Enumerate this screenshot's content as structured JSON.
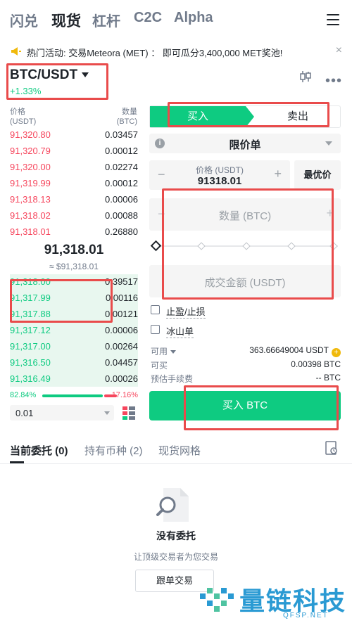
{
  "nav": {
    "tabs": [
      "闪兑",
      "现货",
      "杠杆",
      "C2C",
      "Alpha"
    ],
    "active_index": 1
  },
  "announcement": {
    "text": "热门活动: 交易Meteora (MET) ： 即可瓜分3,400,000 MET奖池!",
    "close": "×"
  },
  "pair": {
    "symbol": "BTC/USDT",
    "change": "+1.33%"
  },
  "orderbook": {
    "price_header": [
      "价格",
      "(USDT)"
    ],
    "qty_header": [
      "数量",
      "(BTC)"
    ],
    "asks": [
      {
        "price": "91,320.80",
        "qty": "0.03457"
      },
      {
        "price": "91,320.79",
        "qty": "0.00012"
      },
      {
        "price": "91,320.00",
        "qty": "0.02274"
      },
      {
        "price": "91,319.99",
        "qty": "0.00012"
      },
      {
        "price": "91,318.13",
        "qty": "0.00006"
      },
      {
        "price": "91,318.02",
        "qty": "0.00088"
      },
      {
        "price": "91,318.01",
        "qty": "0.26880"
      }
    ],
    "mid_price": "91,318.01",
    "mid_fiat": "≈ $91,318.01",
    "bids": [
      {
        "price": "91,318.00",
        "qty": "0.39517"
      },
      {
        "price": "91,317.99",
        "qty": "0.00116"
      },
      {
        "price": "91,317.88",
        "qty": "0.00121"
      },
      {
        "price": "91,317.12",
        "qty": "0.00006"
      },
      {
        "price": "91,317.00",
        "qty": "0.00264"
      },
      {
        "price": "91,316.50",
        "qty": "0.04457"
      },
      {
        "price": "91,316.49",
        "qty": "0.00026"
      }
    ],
    "buy_ratio": "82.84%",
    "sell_ratio": "17.16%",
    "depth": "0.01"
  },
  "form": {
    "buy_tab": "买入",
    "sell_tab": "卖出",
    "order_type": "限价单",
    "price_label": "价格 (USDT)",
    "price_value": "91318.01",
    "best_price": "最优价",
    "qty_placeholder": "数量 (BTC)",
    "amount_placeholder": "成交金额 (USDT)",
    "tpsl": "止盈/止损",
    "iceberg": "冰山单",
    "available_label": "可用",
    "available_value": "363.66649004 USDT",
    "can_buy_label": "可买",
    "can_buy_value": "0.00398 BTC",
    "fee_label": "预估手续费",
    "fee_value": "-- BTC",
    "buy_button": "买入 BTC"
  },
  "bottom": {
    "tabs": [
      "当前委托 (0)",
      "持有币种 (2)",
      "现货网格"
    ],
    "empty_title": "没有委托",
    "empty_sub": "让顶级交易者为您交易",
    "copy_button": "跟单交易"
  },
  "watermark": {
    "name": "量链科技",
    "domain": "QFSP.NET"
  },
  "colors": {
    "buy": "#0ecb81",
    "sell": "#f6465d",
    "highlight": "#e94b4b"
  }
}
